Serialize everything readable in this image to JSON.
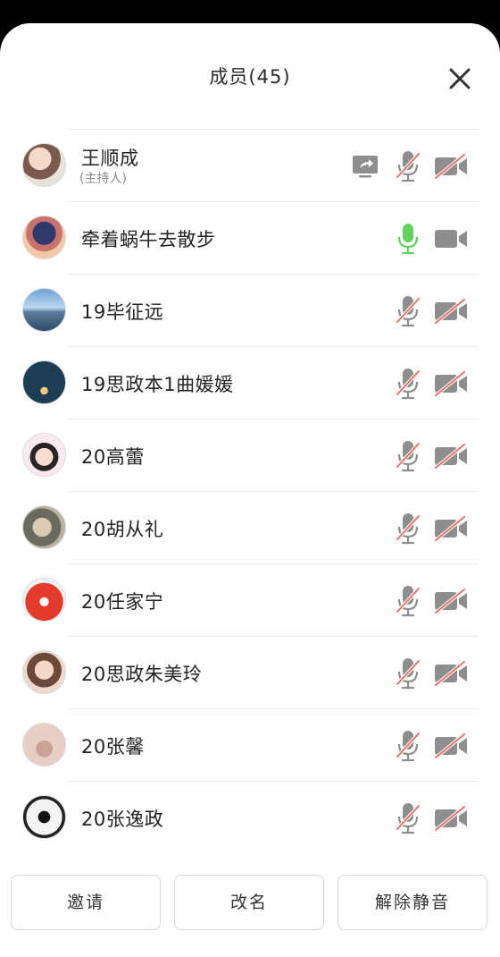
{
  "header": {
    "title": "成员(45)",
    "close_icon": "close-icon"
  },
  "colors": {
    "mic_active": "#5fd35a",
    "icon_gray": "#8e8e8e",
    "muted_slash": "#e8736a"
  },
  "members": [
    {
      "name": "王顺成",
      "role": "(主持人)",
      "sharing": true,
      "mic": "muted",
      "camera": "off"
    },
    {
      "name": "牵着蜗牛去散步",
      "role": "",
      "sharing": false,
      "mic": "active",
      "camera": "on"
    },
    {
      "name": "19毕征远",
      "role": "",
      "sharing": false,
      "mic": "muted",
      "camera": "off"
    },
    {
      "name": "19思政本1曲媛媛",
      "role": "",
      "sharing": false,
      "mic": "muted",
      "camera": "off"
    },
    {
      "name": "20高蕾",
      "role": "",
      "sharing": false,
      "mic": "muted",
      "camera": "off"
    },
    {
      "name": "20胡从礼",
      "role": "",
      "sharing": false,
      "mic": "muted",
      "camera": "off"
    },
    {
      "name": "20任家宁",
      "role": "",
      "sharing": false,
      "mic": "muted",
      "camera": "off"
    },
    {
      "name": "20思政朱美玲",
      "role": "",
      "sharing": false,
      "mic": "muted",
      "camera": "off"
    },
    {
      "name": "20张馨",
      "role": "",
      "sharing": false,
      "mic": "muted",
      "camera": "off"
    },
    {
      "name": "20张逸政",
      "role": "",
      "sharing": false,
      "mic": "muted",
      "camera": "off"
    }
  ],
  "footer": {
    "invite_label": "邀请",
    "rename_label": "改名",
    "unmute_label": "解除静音"
  }
}
